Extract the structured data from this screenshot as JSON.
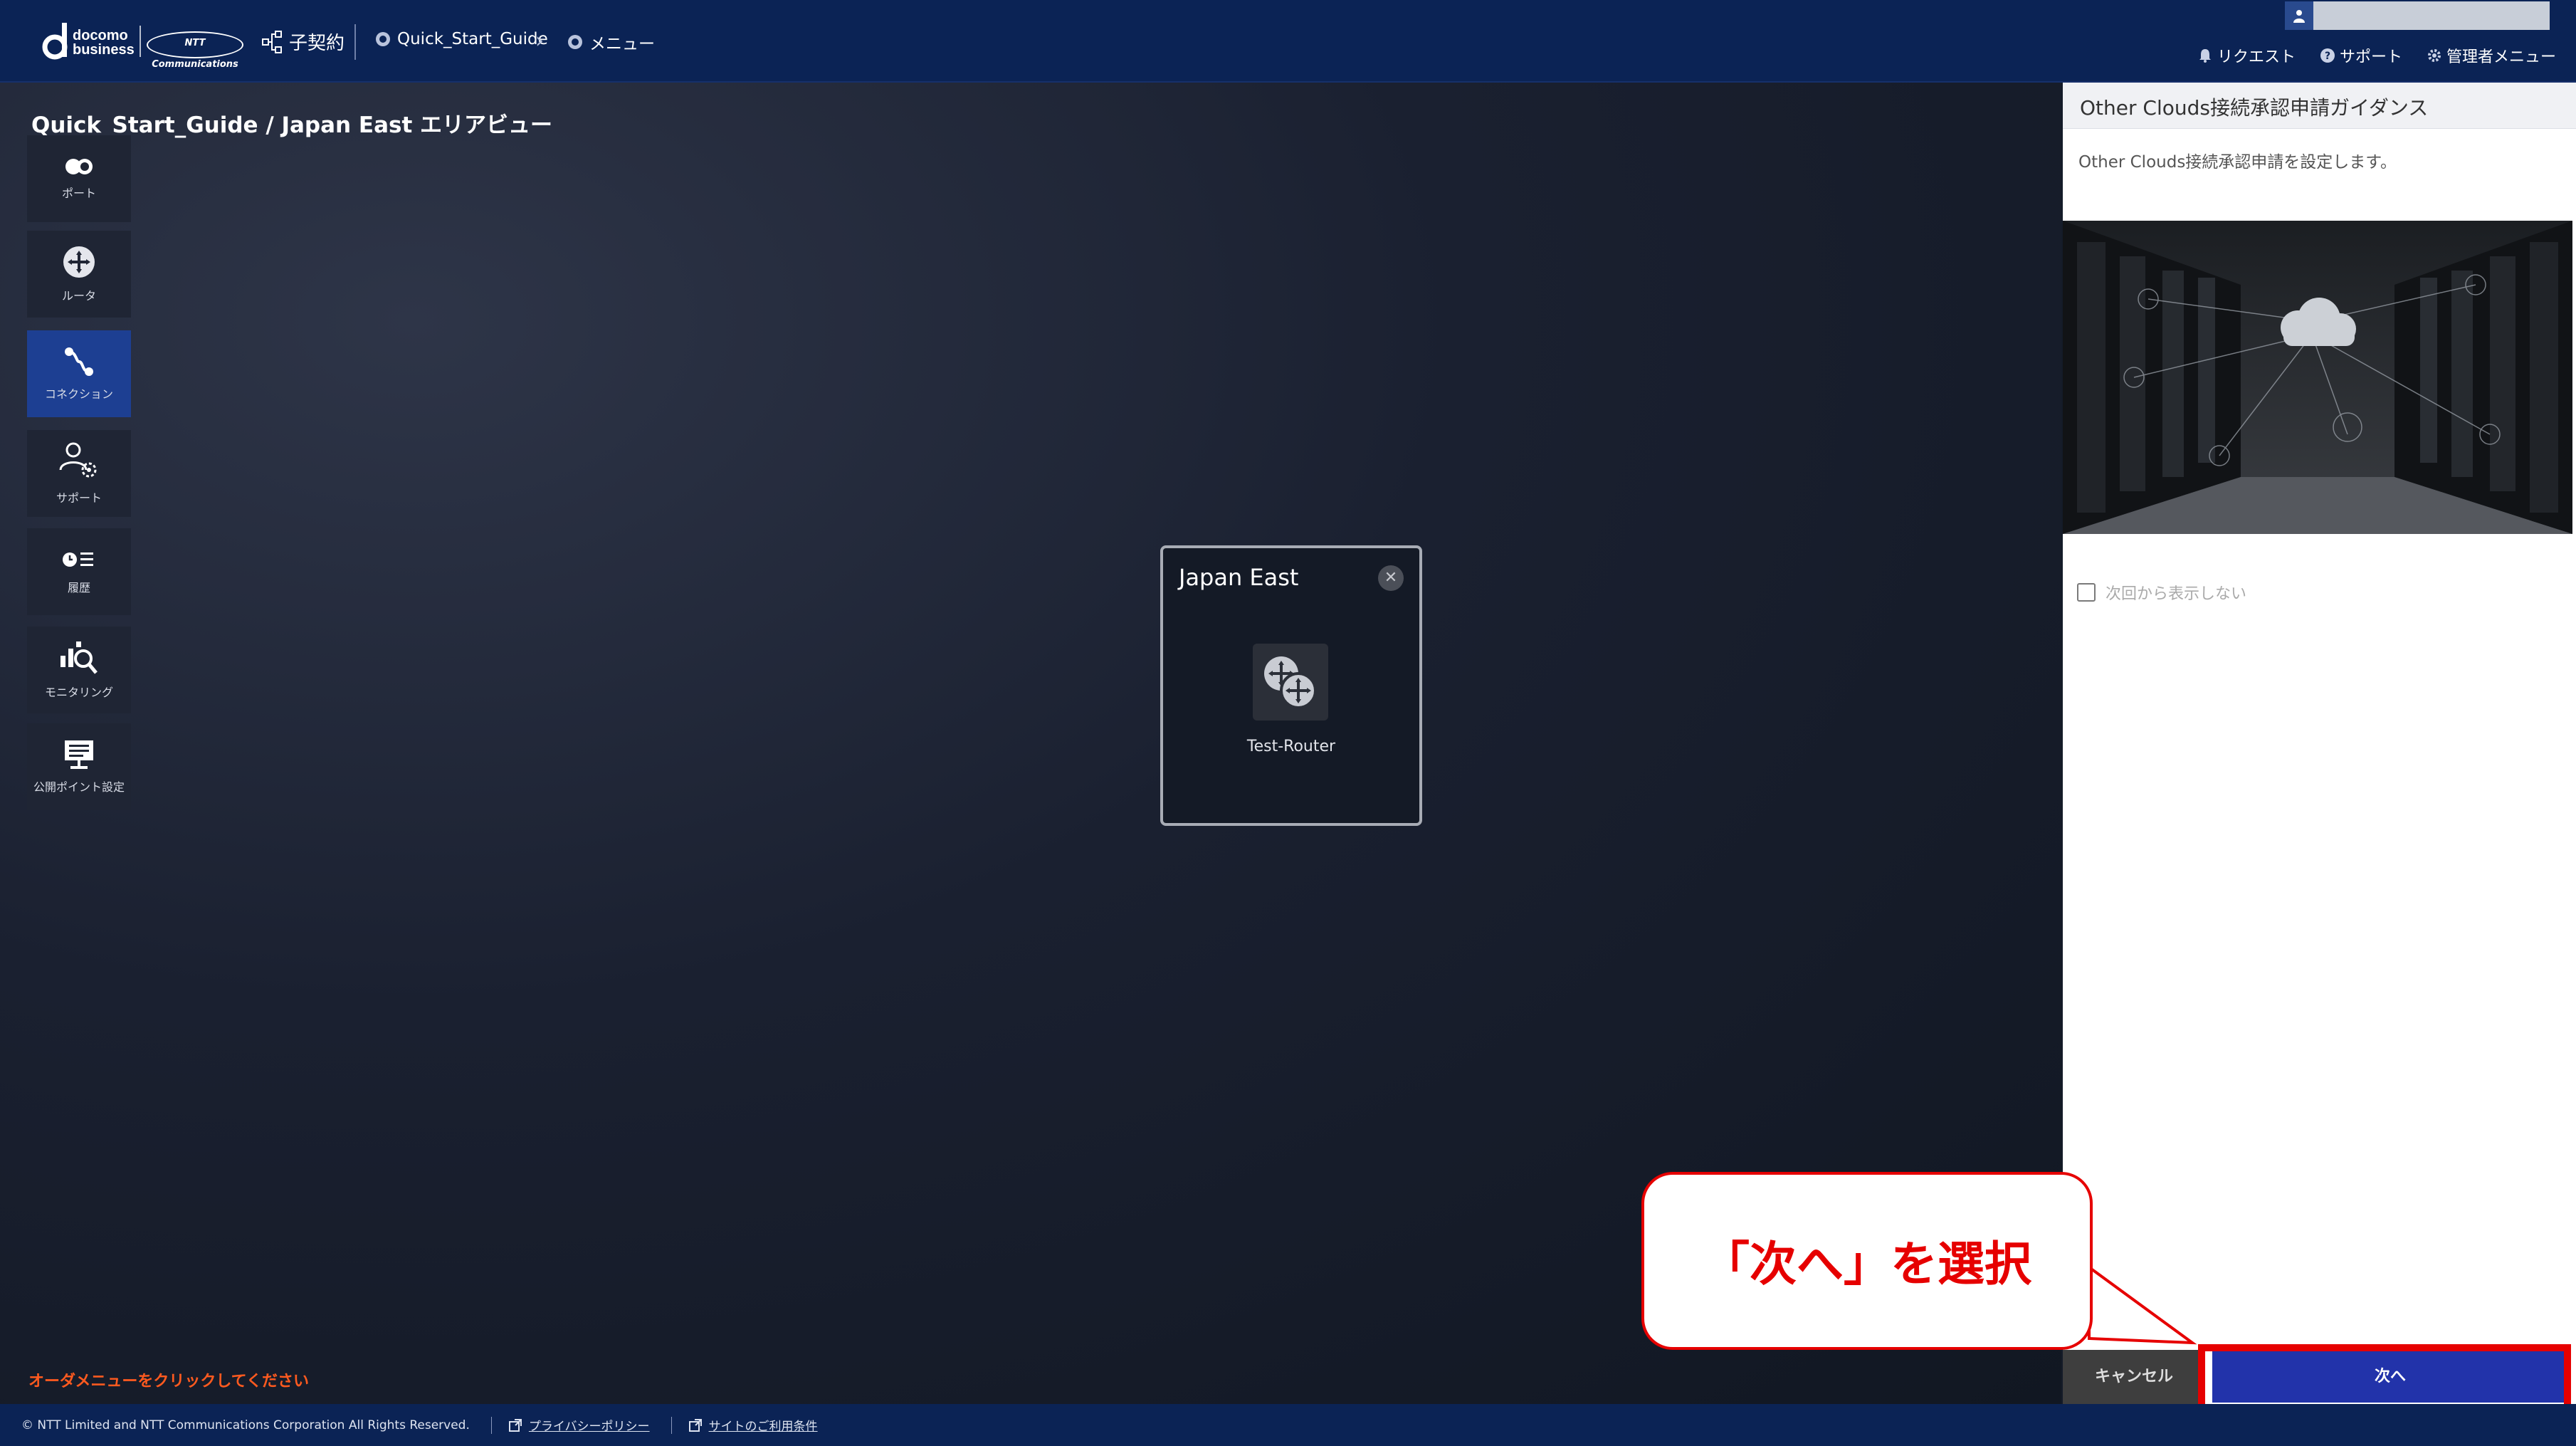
{
  "header": {
    "brand_line1": "docomo",
    "brand_line2": "business",
    "brand_partner": "NTT Communications",
    "contract_label": "子契約",
    "breadcrumbs": [
      {
        "label": "Quick_Start_Guide"
      },
      {
        "label": "メニュー"
      }
    ],
    "user_name": "",
    "links": [
      {
        "label": "リクエスト",
        "icon": "bell-icon"
      },
      {
        "label": "サポート",
        "icon": "help-circle-icon"
      },
      {
        "label": "管理者メニュー",
        "icon": "gear-icon"
      }
    ]
  },
  "canvas": {
    "title": "Quick_Start_Guide / Japan East エリアビュー",
    "order_hint": "オーダメニューをクリックしてください",
    "area_card": {
      "title": "Japan East",
      "router_label": "Test-Router"
    }
  },
  "sidebar": {
    "items": [
      {
        "label": "ポート",
        "icon": "port-icon",
        "active": false
      },
      {
        "label": "ルータ",
        "icon": "router-icon",
        "active": false
      },
      {
        "label": "コネクション",
        "icon": "connection-icon",
        "active": true
      },
      {
        "label": "サポート",
        "icon": "support-user-icon",
        "active": false
      },
      {
        "label": "履歴",
        "icon": "history-icon",
        "active": false
      },
      {
        "label": "モニタリング",
        "icon": "monitoring-icon",
        "active": false
      },
      {
        "label": "公開ポイント設定",
        "icon": "public-point-icon",
        "active": false
      }
    ]
  },
  "panel": {
    "title": "Other Clouds接続承認申請ガイダンス",
    "description": "Other Clouds接続承認申請を設定します。",
    "checkbox_label": "次回から表示しない",
    "cancel_label": "キャンセル",
    "next_label": "次へ"
  },
  "callout": {
    "text": "「次へ」を選択"
  },
  "footer": {
    "copyright": "© NTT Limited and NTT Communications Corporation All Rights Reserved.",
    "privacy_label": "プライバシーポリシー",
    "terms_label": "サイトのご利用条件"
  },
  "colors": {
    "header_bg": "#0b2355",
    "active_nav": "#1d3f92",
    "next_button": "#2233aa",
    "annotation_red": "#e60000",
    "hint_orange": "#ff5a1f"
  }
}
